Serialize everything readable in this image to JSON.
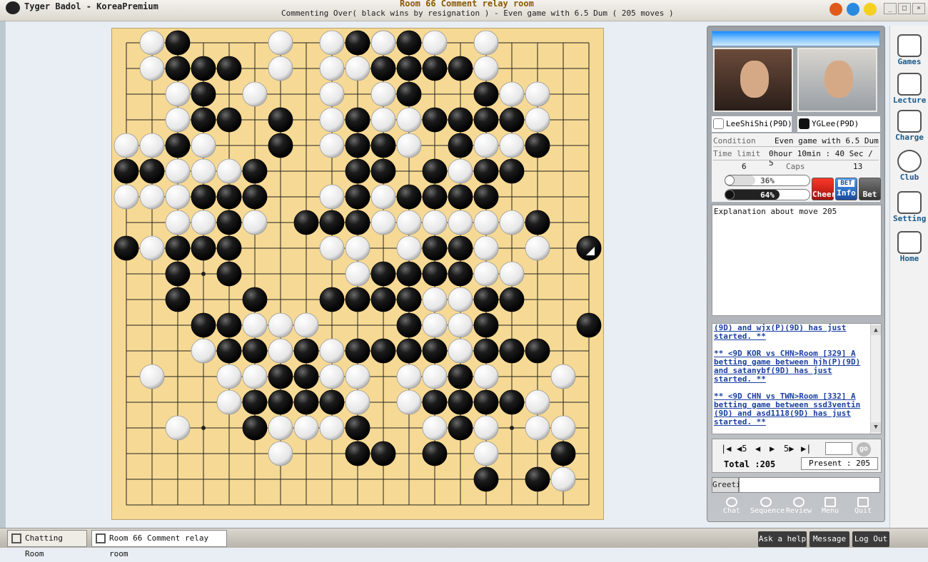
{
  "window": {
    "app_title": "Tyger Badol - KoreaPremium",
    "room_title": "Room 66 Comment relay room",
    "status": "Commenting Over( black wins by resignation ) - Even game with 6.5 Dum  ( 205 moves )"
  },
  "players": {
    "white": "LeeShiShi(P9D)",
    "black": "YGLee(P9D)"
  },
  "info": {
    "condition_label": "Condition",
    "condition_value": "Even game with 6.5 Dum",
    "time_label": "Time limit",
    "time_value": "0hour 10min : 40 Sec / 5",
    "caps_white": "6",
    "caps_label": "Caps",
    "caps_black": "13",
    "bar_white": "36%",
    "bar_black": "64%",
    "bar_white_fraction": 0.36,
    "bar_black_fraction": 0.64
  },
  "buttons": {
    "cheer": "Cheer",
    "info": "Info",
    "bet": "Bet",
    "bet_tag": "BET"
  },
  "explanation": "Explanation about move 205",
  "chat_messages": [
    "(9D) and wjx(P)(9D) has just started. **",
    "** <9D KOR vs CHN>Room [329] A betting game between hjh(P)(9D) and satanybf(9D) has just started. **",
    "** <9D CHN vs TWN>Room [332] A betting game between ssd3ventin (9D) and asd1118(9D) has just started. **"
  ],
  "nav": {
    "first": "|◀",
    "back5": "◀5",
    "back": "◀",
    "forward": "▶",
    "forward5": "5▶",
    "last": "▶|",
    "go": "go",
    "total_label": "Total :205",
    "present_label": "Present : 205"
  },
  "greeting_label": "Greeting",
  "tools": [
    "Chat",
    "Sequence",
    "Review",
    "Menu",
    "Quit"
  ],
  "sidebar": [
    "Games",
    "Lecture",
    "Charge",
    "Club",
    "Setting",
    "Home"
  ],
  "taskbar": {
    "tab1": "Chatting Room",
    "tab2": "Room 66 Comment relay room",
    "ask_help": "Ask a help",
    "message": "Message",
    "logout": "Log Out"
  },
  "board": {
    "size": 19,
    "rows": [
      ".WB...W.WB.BW.W....",
      ".WBBB.W.WWBBBBW....",
      "..WB.W..W.WB..BWW..",
      "..WBB.B.WBWWBBBBW..",
      "WWBW..B.WBBW.BWWB..",
      "BBWWWB...BB.BWBB...",
      "WWWBBB..WBWBBBB....",
      "..WWBW.BBBWWWWWWB..",
      "BWBBB...WW.WBBW.W..",
      "..B.B....WBBBBWW...",
      "..B..B..BBBBWWBB...",
      "...BBWWW...BWWB...B",
      "...WBBWBWBBBBWBBB..",
      ".W..WWBBWW.WWBW..W.",
      "....WBBBBW.WBBBBW..",
      "..W..BWWWB..WBW.WW.",
      "......W..BB.B.W..B.",
      "..............B.BW.",
      "..................."
    ],
    "last_move": "W-edge"
  },
  "colors": {
    "board": "#f6d994",
    "panel_header": "#1a8aff",
    "link": "#1a3fa0"
  }
}
